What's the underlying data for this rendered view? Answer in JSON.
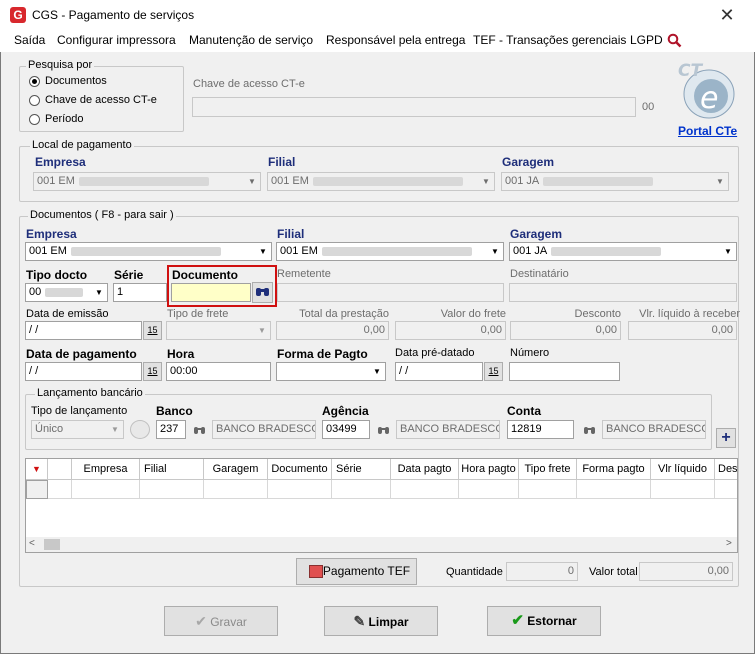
{
  "window": {
    "title": "CGS - Pagamento de serviços",
    "close_label": "✕"
  },
  "menu": [
    "Saída",
    "Configurar impressora",
    "Manutenção de serviço",
    "Responsável pela entrega",
    "TEF - Transações gerenciais",
    "LGPD"
  ],
  "pesquisa": {
    "legend": "Pesquisa por",
    "options": [
      "Documentos",
      "Chave de acesso CT-e",
      "Período"
    ],
    "selected": "Documentos",
    "chave_label": "Chave de acesso CT-e",
    "chave_value": "",
    "chave_suffix": "00",
    "portal_link": "Portal CTe",
    "logo_text": "CT e"
  },
  "local": {
    "legend": "Local de pagamento",
    "empresa_label": "Empresa",
    "empresa_value": "001 EM",
    "filial_label": "Filial",
    "filial_value": "001 EM",
    "garagem_label": "Garagem",
    "garagem_value": "001 JA"
  },
  "documentos": {
    "legend": "Documentos ( F8 - para sair )",
    "empresa_label": "Empresa",
    "empresa_value": "001 EM",
    "filial_label": "Filial",
    "filial_value": "001 EM",
    "garagem_label": "Garagem",
    "garagem_value": "001 JA",
    "tipo_docto_label": "Tipo docto",
    "tipo_docto_value": "00",
    "serie_label": "Série",
    "serie_value": "1",
    "documento_label": "Documento",
    "documento_value": "",
    "remetente_label": "Remetente",
    "destinatario_label": "Destinatário",
    "data_emissao_label": "Data de emissão",
    "data_emissao_value": " / /",
    "tipo_frete_label": "Tipo de frete",
    "total_prestacao_label": "Total da prestação",
    "total_prestacao_value": "0,00",
    "valor_frete_label": "Valor do frete",
    "valor_frete_value": "0,00",
    "desconto_label": "Desconto",
    "desconto_value": "0,00",
    "vlr_liquido_label": "Vlr. líquido à receber",
    "vlr_liquido_value": "0,00",
    "data_pagamento_label": "Data de pagamento",
    "data_pagamento_value": " / /",
    "hora_label": "Hora",
    "hora_value": "00:00",
    "forma_pagto_label": "Forma de Pagto",
    "forma_pagto_value": "",
    "data_predatado_label": "Data pré-datado",
    "data_predatado_value": " / /",
    "numero_label": "Número",
    "numero_value": "",
    "calendar_label": "15"
  },
  "bancario": {
    "legend": "Lançamento bancário",
    "tipo_label": "Tipo de lançamento",
    "tipo_value": "Único",
    "banco_label": "Banco",
    "banco_code": "237",
    "banco_name": "BANCO BRADESCO",
    "agencia_label": "Agência",
    "agencia_code": "03499",
    "agencia_name": "BANCO BRADESCO",
    "conta_label": "Conta",
    "conta_code": "12819",
    "conta_name": "BANCO BRADESCO",
    "add_label": "+"
  },
  "grid": {
    "columns": [
      "Empresa",
      "Filial",
      "Garagem",
      "Documento",
      "Série",
      "Data pagto",
      "Hora pagto",
      "Tipo frete",
      "Forma pagto",
      "Vlr líquido",
      "Des"
    ]
  },
  "footer": {
    "pagamento_tef": "Pagamento TEF",
    "quantidade_label": "Quantidade",
    "quantidade_value": "0",
    "valor_total_label": "Valor total",
    "valor_total_value": "0,00"
  },
  "actions": {
    "gravar": "Gravar",
    "limpar": "Limpar",
    "estornar": "Estornar"
  },
  "colors": {
    "accent_red": "#d01010",
    "doc_field_bg": "#ffffc8",
    "link_blue": "#0033cc"
  }
}
